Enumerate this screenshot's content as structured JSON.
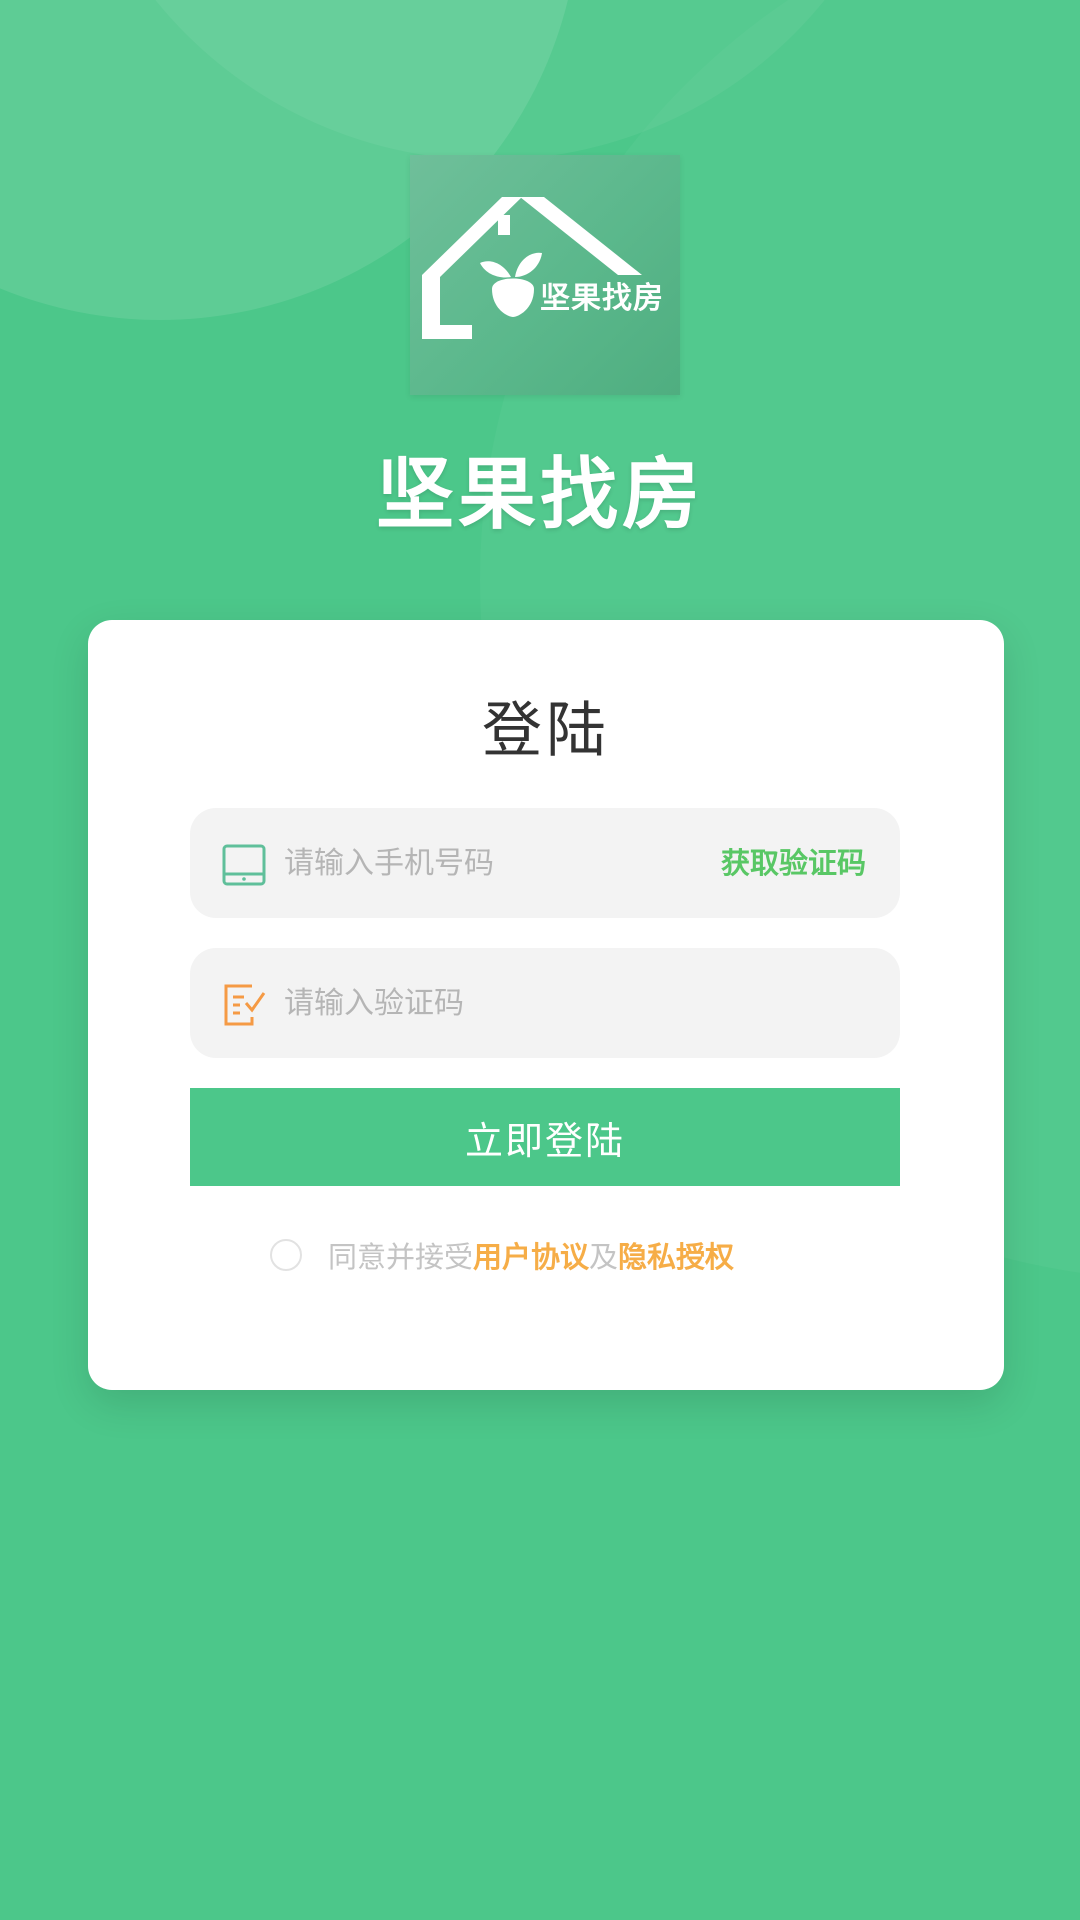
{
  "header": {
    "logo_icon": "house-leaf-logo-icon",
    "logo_text": "坚果找房",
    "app_title": "坚果找房"
  },
  "card": {
    "title": "登陆",
    "phone_field": {
      "icon": "tablet-icon",
      "placeholder": "请输入手机号码",
      "value": ""
    },
    "get_code_label": "获取验证码",
    "code_field": {
      "icon": "edit-check-icon",
      "placeholder": "请输入验证码",
      "value": ""
    },
    "login_label": "立即登陆",
    "agreement": {
      "checked": false,
      "prefix": "同意并接受",
      "user_agreement": "用户协议",
      "and": "及",
      "privacy": "隐私授权"
    }
  },
  "colors": {
    "background": "#4cc78a",
    "button": "#4cc78a",
    "get_code": "#59c765",
    "link": "#f6ad47",
    "phone_icon": "#5fbf9a",
    "code_icon": "#f59a44"
  }
}
